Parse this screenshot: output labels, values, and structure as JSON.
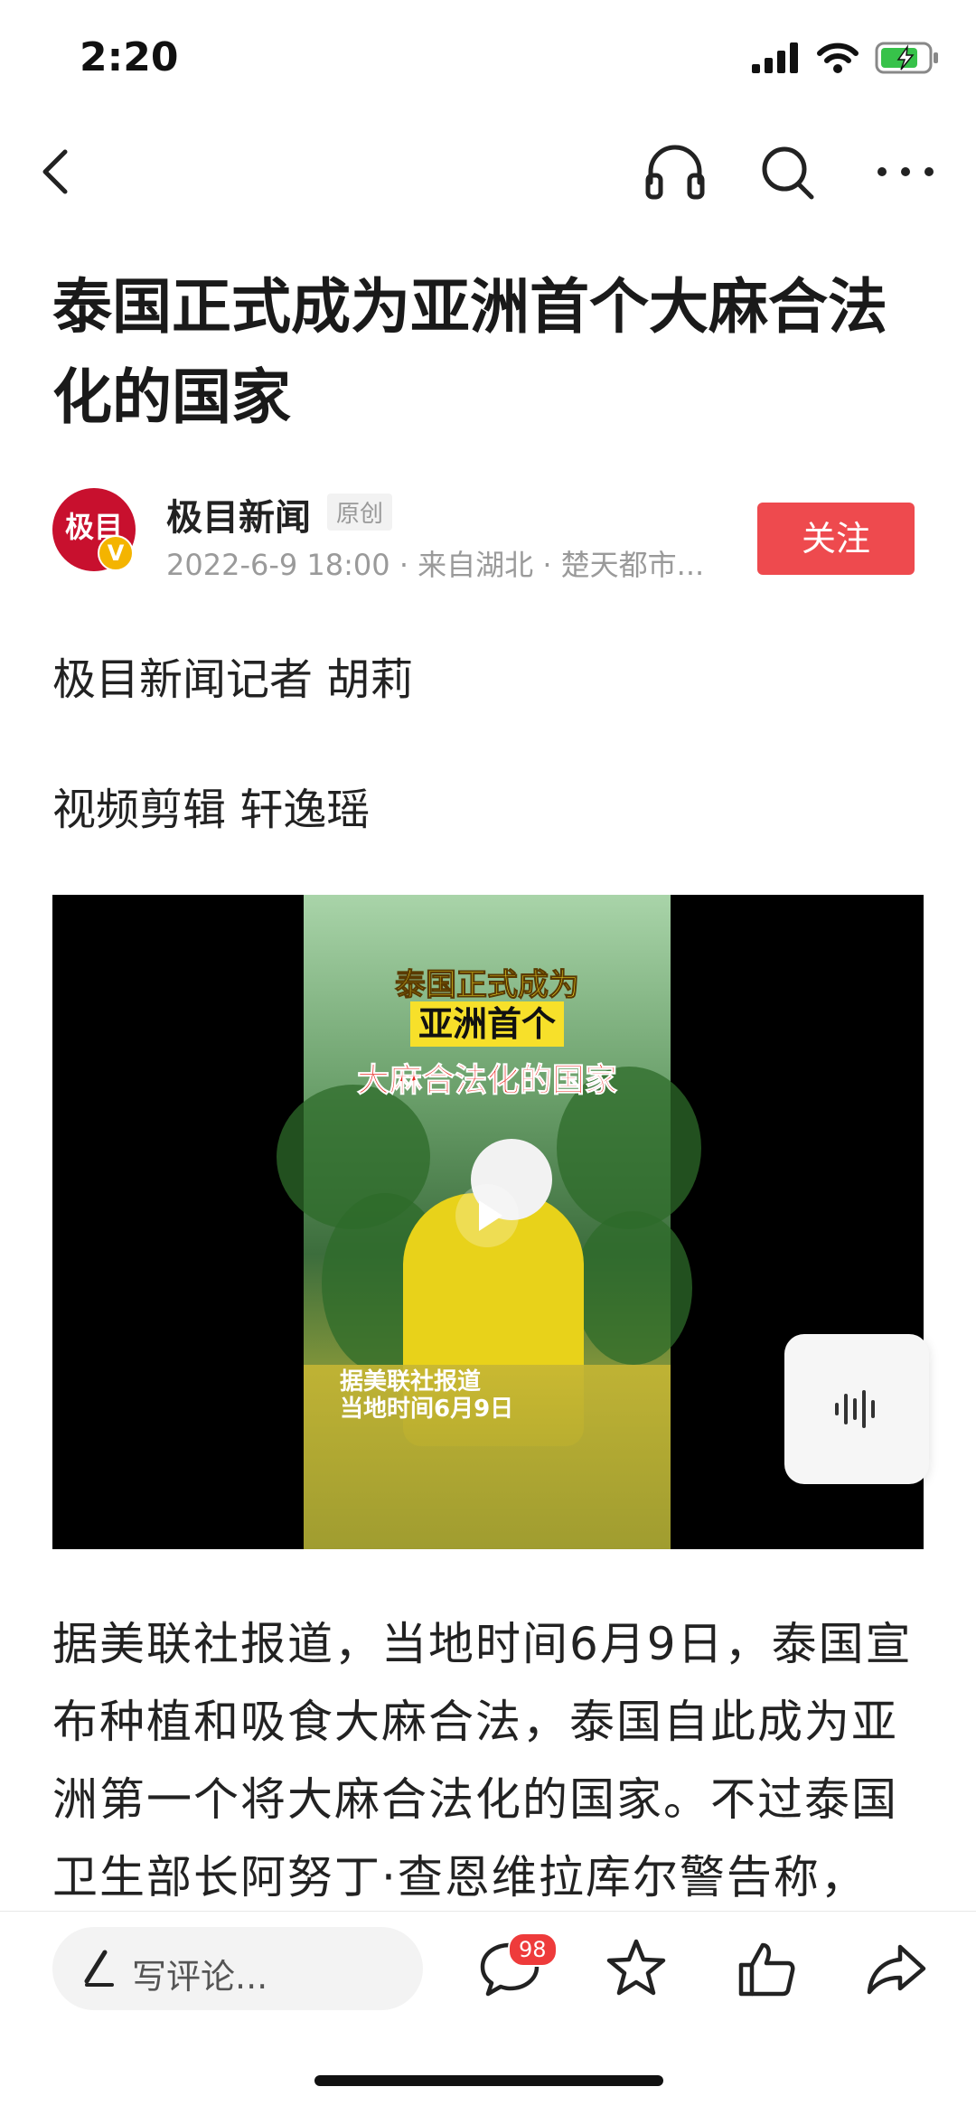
{
  "status_bar": {
    "time": "2:20"
  },
  "article": {
    "title": "泰国正式成为亚洲首个大麻合法化的国家",
    "author": {
      "name": "极目新闻",
      "avatar_text": "极目",
      "verified_mark": "V",
      "badge": "原创",
      "meta": "2022-6-9 18:00 · 来自湖北 · 楚天都市..."
    },
    "follow_label": "关注",
    "reporter_line": "极目新闻记者 胡莉",
    "editor_line": "视频剪辑 轩逸瑶",
    "video": {
      "caption_line1": "泰国正式成为",
      "caption_line2": "亚洲首个",
      "caption_line3": "大麻合法化的国家",
      "caption_source": "据美联社报道",
      "caption_date": "当地时间6月9日"
    },
    "paragraph": "据美联社报道，当地时间6月9日，泰国宣布种植和吸食大麻合法，泰国自此成为亚洲第一个将大麻合法化的国家。不过泰国卫生部长阿努丁·查恩维拉库尔警告称，"
  },
  "bottom_bar": {
    "comment_placeholder": "写评论...",
    "comment_count": "98"
  },
  "colors": {
    "accent": "#ee4a4e",
    "badge_red": "#ee3b3b"
  }
}
